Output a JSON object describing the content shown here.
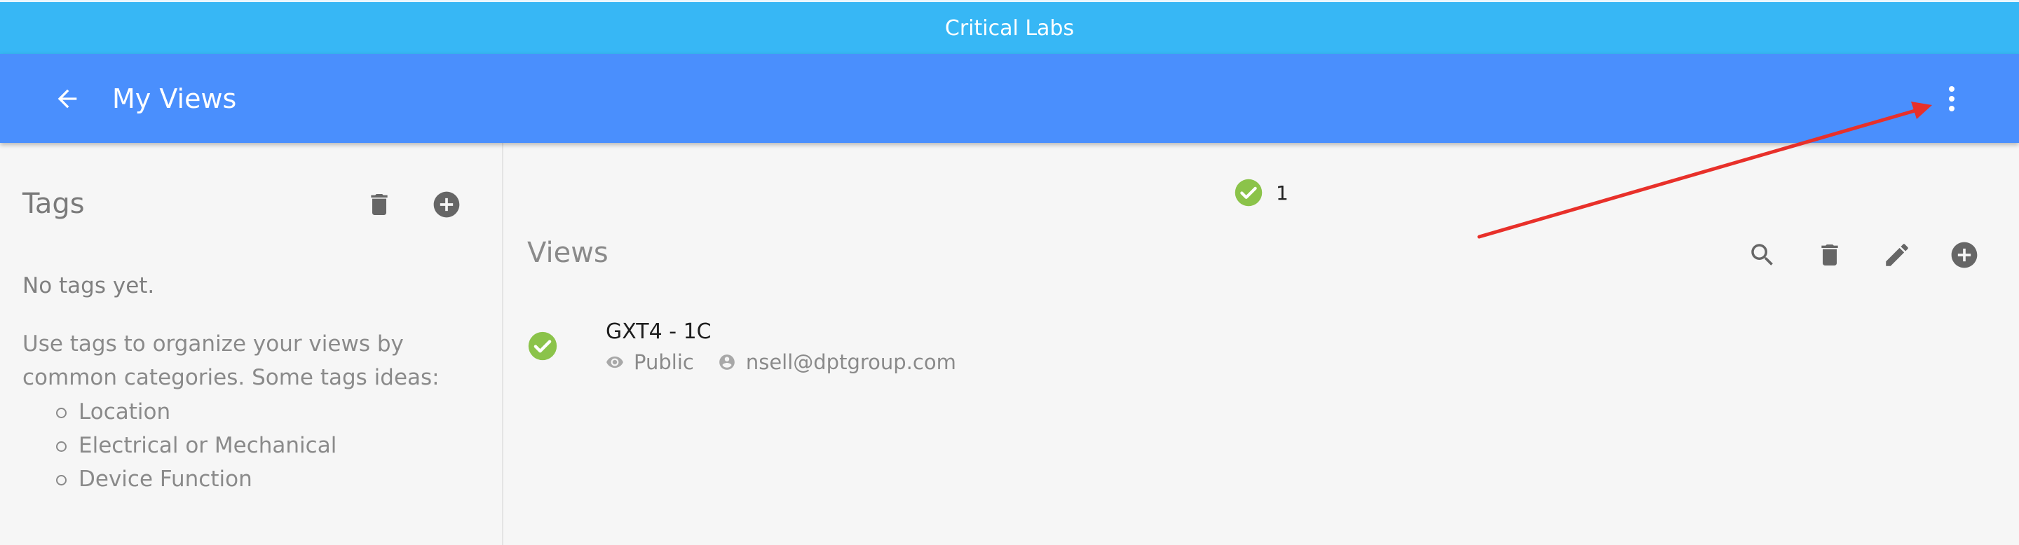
{
  "app": {
    "title": "Critical Labs"
  },
  "header": {
    "title": "My Views"
  },
  "sidebar": {
    "title": "Tags",
    "empty_text": "No tags yet.",
    "help_text": "Use tags to organize your views by common categories. Some tags ideas:",
    "tag_ideas": [
      "Location",
      "Electrical or Mechanical",
      "Device Function"
    ]
  },
  "main": {
    "selected_count": "1",
    "views_title": "Views",
    "views": [
      {
        "name": "GXT4 - 1C",
        "visibility": "Public",
        "owner": "nsell@dptgroup.com"
      }
    ]
  },
  "colors": {
    "topbar": "#37b7f5",
    "header": "#4a8ffd",
    "success": "#8bc34a",
    "icon_gray": "#666666",
    "annotation_arrow": "#e8302a"
  },
  "icons": {
    "back": "arrow-left-icon",
    "menu": "more-vert-icon",
    "delete": "trash-icon",
    "add": "add-circle-icon",
    "search": "search-icon",
    "edit": "pencil-icon",
    "status": "check-circle-icon",
    "visibility": "eye-icon",
    "owner": "account-circle-icon"
  }
}
